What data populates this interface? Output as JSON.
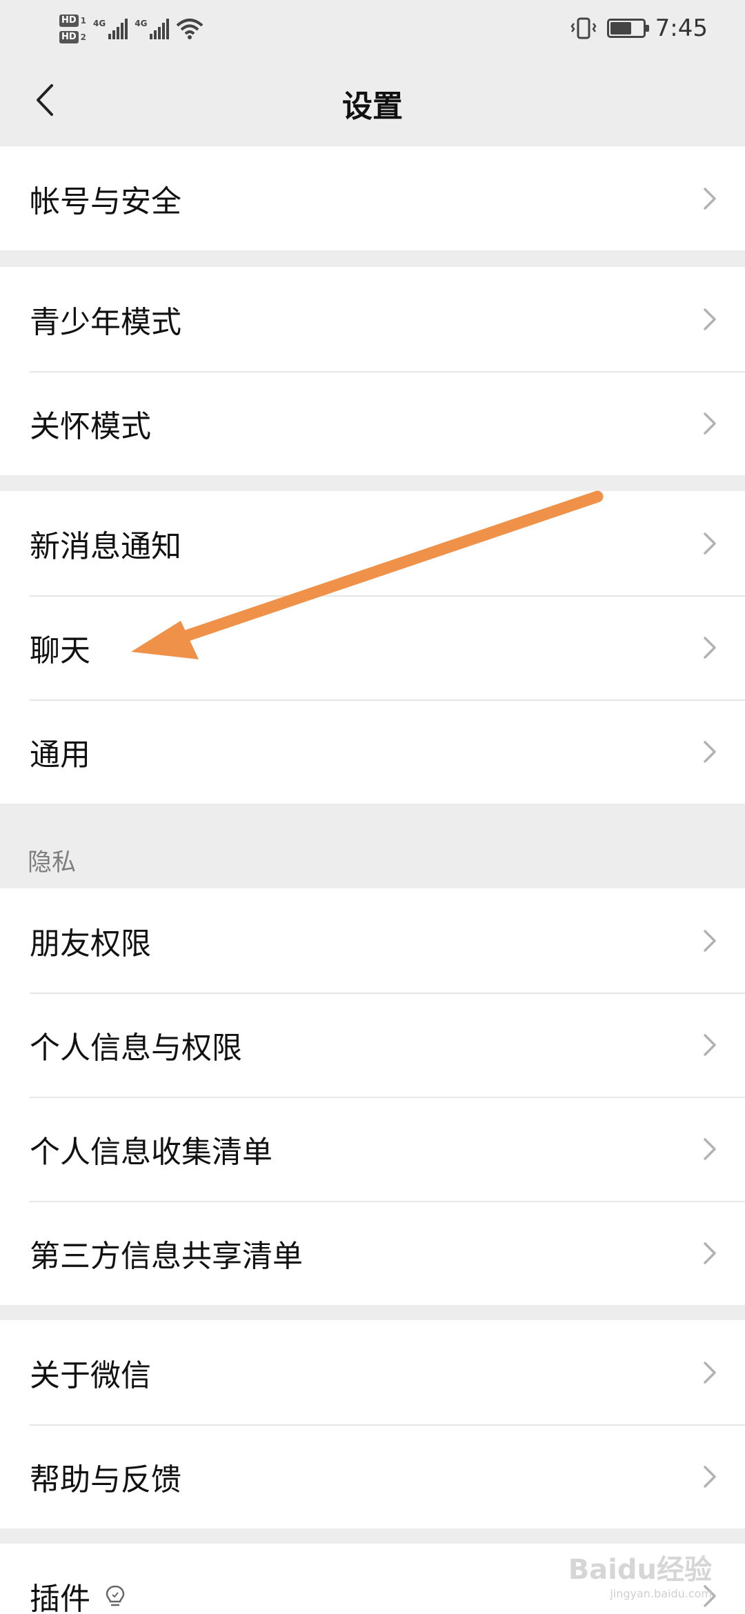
{
  "status_bar": {
    "sim1": "HD",
    "sim1_num": "1",
    "sim2": "HD",
    "sim2_num": "2",
    "network1": "4G",
    "network2": "4G",
    "time": "7:45"
  },
  "header": {
    "title": "设置"
  },
  "groups": {
    "account": {
      "items": [
        "帐号与安全"
      ]
    },
    "modes": {
      "items": [
        "青少年模式",
        "关怀模式"
      ]
    },
    "general": {
      "items": [
        "新消息通知",
        "聊天",
        "通用"
      ]
    },
    "privacy": {
      "title": "隐私",
      "items": [
        "朋友权限",
        "个人信息与权限",
        "个人信息收集清单",
        "第三方信息共享清单"
      ]
    },
    "about": {
      "items": [
        "关于微信",
        "帮助与反馈"
      ]
    },
    "plugins": {
      "items": [
        "插件"
      ]
    }
  },
  "annotation": {
    "color": "#f0914a"
  },
  "watermark": {
    "text": "Baidu经验",
    "url": "jingyan.baidu.com"
  },
  "colors": {
    "background": "#ededed",
    "cell": "#ffffff",
    "text": "#111111",
    "secondary_text": "#7f7f7f",
    "chevron": "#b2b2b2"
  }
}
